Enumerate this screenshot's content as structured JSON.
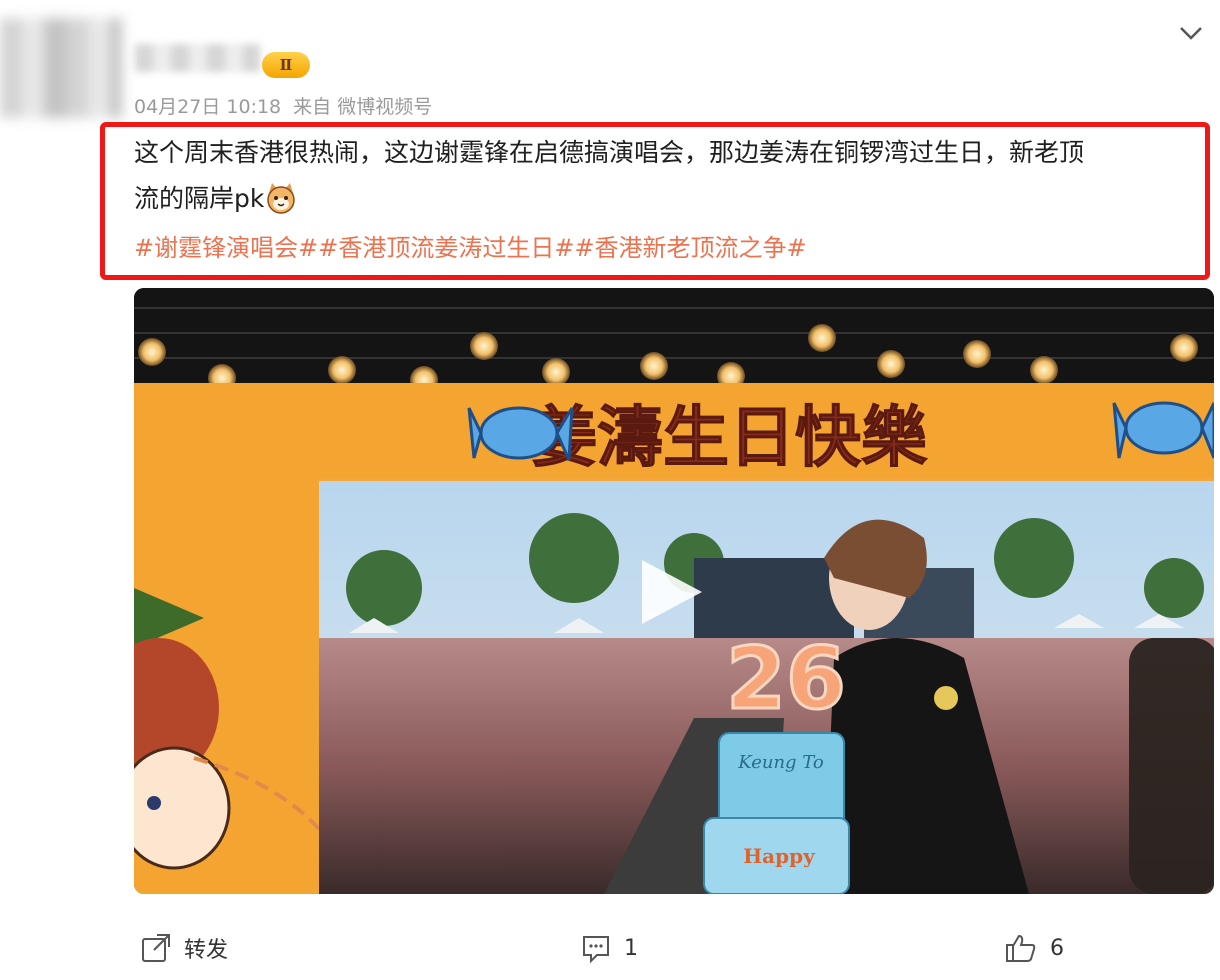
{
  "post": {
    "vip_label": "Ⅱ",
    "date": "04月27日 10:18",
    "source_prefix": "来自",
    "source": "微博视频号",
    "text_line1": "这个周末香港很热闹，这边谢霆锋在启德搞演唱会，那边姜涛在铜锣湾过生日，新老顶",
    "text_line2": "流的隔岸pk",
    "hashtags": [
      "#谢霆锋演唱会#",
      "#香港顶流姜涛过生日#",
      "#香港新老顶流之争#"
    ],
    "emoji_icon": "cat-face-emoji-icon"
  },
  "video": {
    "banner_text": "姜濤生日快樂",
    "cake_number": "26",
    "cake_text": "Keung To",
    "cake_text2": "Happy",
    "play_icon": "play-icon"
  },
  "actions": {
    "repost_label": "转发",
    "comment_count": "1",
    "like_count": "6"
  },
  "colors": {
    "highlight_border": "#f01717",
    "hashtag": "#eb7350",
    "meta_text": "#9a9a9a"
  }
}
